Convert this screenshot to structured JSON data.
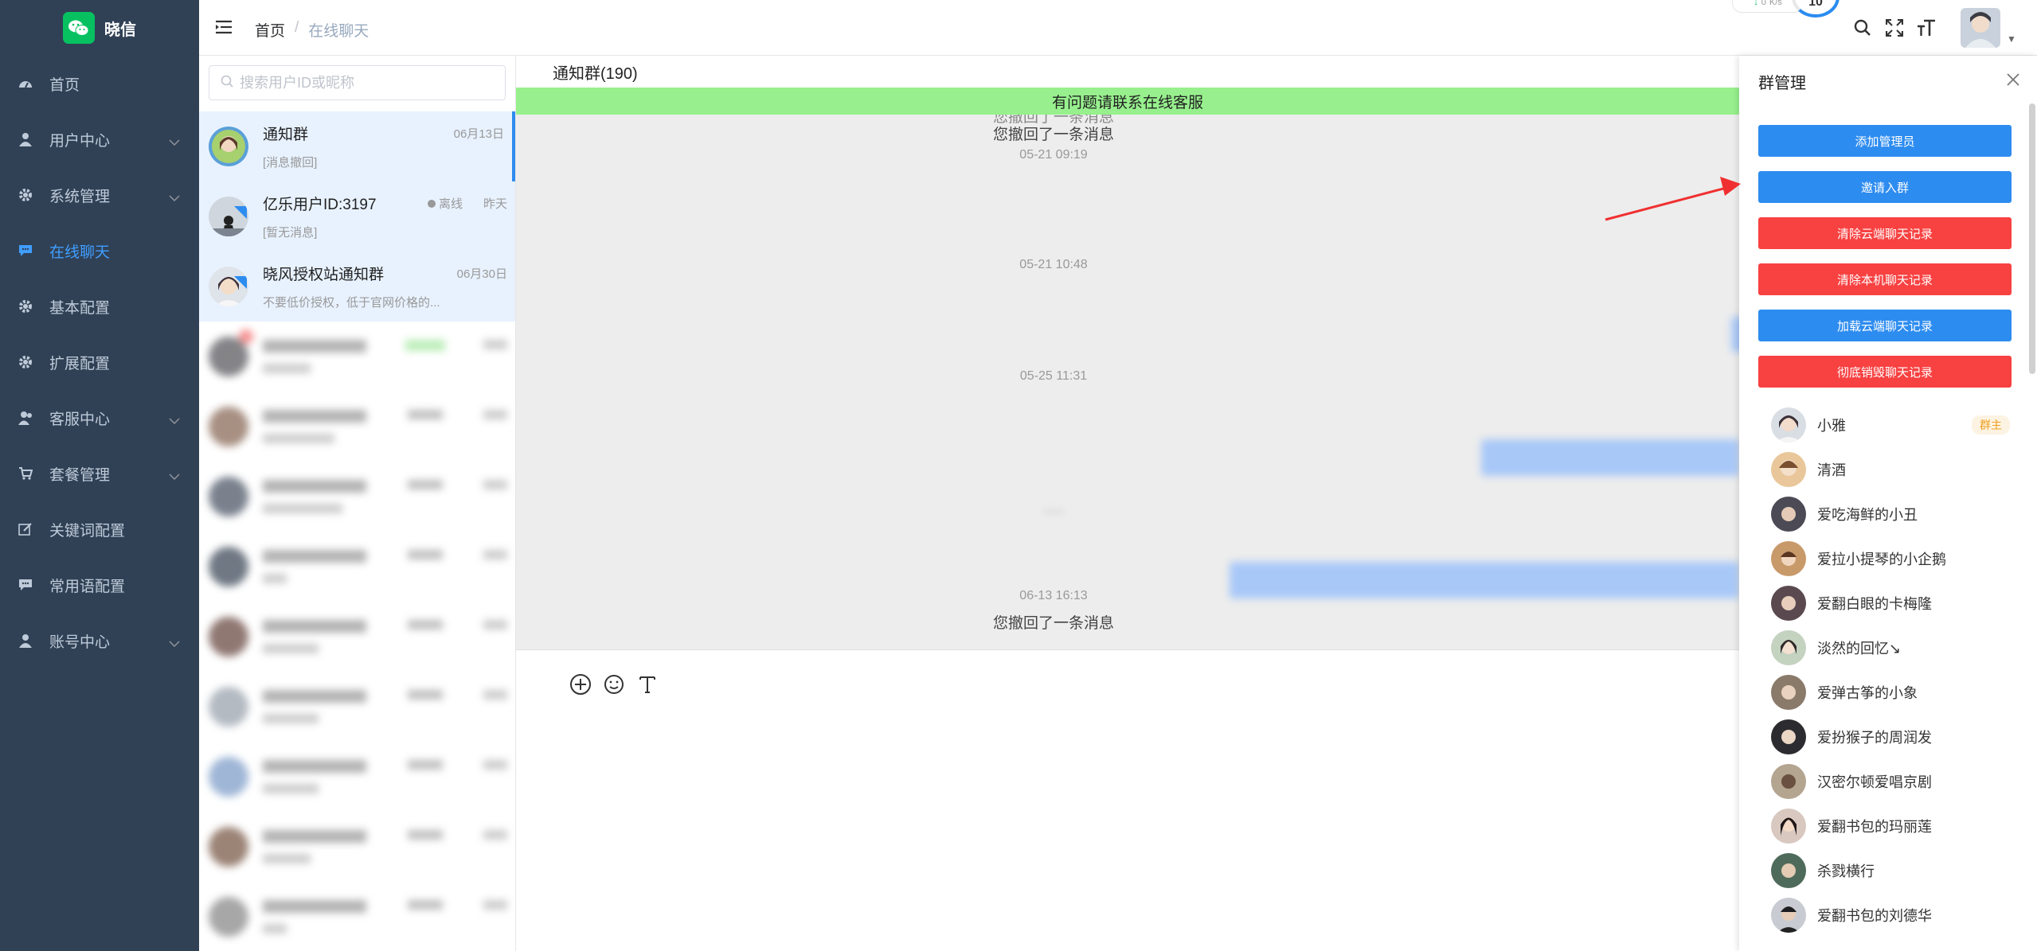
{
  "sidebar": {
    "brand": "晓信",
    "items": [
      {
        "label": "首页",
        "icon": "dashboard-icon",
        "has_children": false,
        "active": false
      },
      {
        "label": "用户中心",
        "icon": "user-icon",
        "has_children": true,
        "active": false
      },
      {
        "label": "系统管理",
        "icon": "gear-icon",
        "has_children": true,
        "active": false
      },
      {
        "label": "在线聊天",
        "icon": "chat-icon",
        "has_children": false,
        "active": true
      },
      {
        "label": "基本配置",
        "icon": "gear-icon",
        "has_children": false,
        "active": false
      },
      {
        "label": "扩展配置",
        "icon": "gear-icon",
        "has_children": false,
        "active": false
      },
      {
        "label": "客服中心",
        "icon": "service-icon",
        "has_children": true,
        "active": false
      },
      {
        "label": "套餐管理",
        "icon": "cart-icon",
        "has_children": true,
        "active": false
      },
      {
        "label": "关键词配置",
        "icon": "edit-icon",
        "has_children": false,
        "active": false
      },
      {
        "label": "常用语配置",
        "icon": "chat-icon",
        "has_children": false,
        "active": false
      },
      {
        "label": "账号中心",
        "icon": "user-icon",
        "has_children": true,
        "active": false
      }
    ]
  },
  "header": {
    "breadcrumb_home": "首页",
    "breadcrumb_sep": "/",
    "breadcrumb_current": "在线聊天",
    "net_speed": "0",
    "net_unit": "K/s",
    "speed_value": "10"
  },
  "chatlist": {
    "search_placeholder": "搜索用户ID或昵称",
    "items": [
      {
        "name": "通知群",
        "time": "06月13日",
        "preview": "[消息撤回]",
        "status": ""
      },
      {
        "name": "亿乐用户ID:3197",
        "time": "昨天",
        "preview": "[暂无消息]",
        "status": "离线"
      },
      {
        "name": "晓风授权站通知群",
        "time": "06月30日",
        "preview": "不要低价授权，低于官网价格的...",
        "status": ""
      }
    ]
  },
  "chat": {
    "title": "通知群(190)",
    "notice": "有问题请联系在线客服",
    "recall_text": "您撤回了一条消息",
    "timestamps": [
      "05-21 09:19",
      "05-21 10:48",
      "05-25 11:31",
      "06-13 16:13"
    ]
  },
  "group_panel": {
    "title": "群管理",
    "buttons": [
      {
        "label": "添加管理员",
        "color": "#2d8cf0"
      },
      {
        "label": "邀请入群",
        "color": "#2d8cf0"
      },
      {
        "label": "清除云端聊天记录",
        "color": "#f84141"
      },
      {
        "label": "清除本机聊天记录",
        "color": "#f84141"
      },
      {
        "label": "加载云端聊天记录",
        "color": "#2d8cf0"
      },
      {
        "label": "彻底销毁聊天记录",
        "color": "#f84141"
      }
    ],
    "owner_tag": "群主",
    "members": [
      "小雅",
      "清酒",
      "爱吃海鲜的小丑",
      "爱拉小提琴的小企鹅",
      "爱翻白眼的卡梅隆",
      "淡然的回忆↘",
      "爱弹古筝的小象",
      "爱扮猴子的周润发",
      "汉密尔顿爱唱京剧",
      "爱翻书包的玛丽莲",
      "杀戮横行",
      "爱翻书包的刘德华"
    ]
  },
  "colors": {
    "sidebar_bg": "#304156",
    "accent": "#409eff",
    "notice_bg": "#97f08d",
    "danger": "#f84141",
    "primary": "#2d8cf0"
  }
}
